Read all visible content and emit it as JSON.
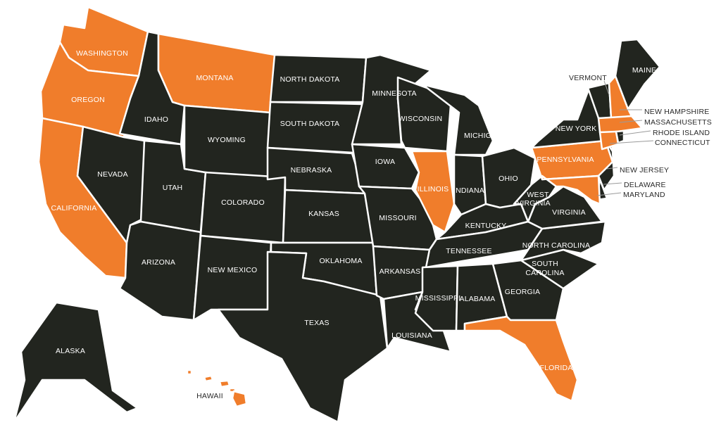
{
  "colors": {
    "highlighted": "#f07d2b",
    "default": "#22251f",
    "border": "#ffffff",
    "outside_label": "#2a2a2a"
  },
  "states": [
    {
      "id": "WA",
      "name": "WASHINGTON",
      "highlighted": true
    },
    {
      "id": "OR",
      "name": "OREGON",
      "highlighted": true
    },
    {
      "id": "CA",
      "name": "CALIFORNIA",
      "highlighted": true
    },
    {
      "id": "ID",
      "name": "IDAHO",
      "highlighted": false
    },
    {
      "id": "MT",
      "name": "MONTANA",
      "highlighted": true
    },
    {
      "id": "NV",
      "name": "NEVADA",
      "highlighted": false
    },
    {
      "id": "UT",
      "name": "UTAH",
      "highlighted": false
    },
    {
      "id": "AZ",
      "name": "ARIZONA",
      "highlighted": false
    },
    {
      "id": "WY",
      "name": "WYOMING",
      "highlighted": false
    },
    {
      "id": "CO",
      "name": "COLORADO",
      "highlighted": false
    },
    {
      "id": "NM",
      "name": "NEW  MEXICO",
      "highlighted": false
    },
    {
      "id": "ND",
      "name": "NORTH  DAKOTA",
      "highlighted": false
    },
    {
      "id": "SD",
      "name": "SOUTH  DAKOTA",
      "highlighted": false
    },
    {
      "id": "NE",
      "name": "NEBRASKA",
      "highlighted": false
    },
    {
      "id": "KS",
      "name": "KANSAS",
      "highlighted": false
    },
    {
      "id": "OK",
      "name": "OKLAHOMA",
      "highlighted": false
    },
    {
      "id": "TX",
      "name": "TEXAS",
      "highlighted": false
    },
    {
      "id": "MN",
      "name": "MINNESOTA",
      "highlighted": false
    },
    {
      "id": "IA",
      "name": "IOWA",
      "highlighted": false
    },
    {
      "id": "MO",
      "name": "MISSOURI",
      "highlighted": false
    },
    {
      "id": "AR",
      "name": "ARKANSAS",
      "highlighted": false
    },
    {
      "id": "LA",
      "name": "LOUISIANA",
      "highlighted": false
    },
    {
      "id": "WI",
      "name": "WISCONSIN",
      "highlighted": false
    },
    {
      "id": "IL",
      "name": "ILLINOIS",
      "highlighted": true
    },
    {
      "id": "MI",
      "name": "MICHIGAN",
      "highlighted": false
    },
    {
      "id": "IN",
      "name": "INDIANA",
      "highlighted": false
    },
    {
      "id": "OH",
      "name": "OHIO",
      "highlighted": false
    },
    {
      "id": "KY",
      "name": "KENTUCKY",
      "highlighted": false
    },
    {
      "id": "TN",
      "name": "TENNESSEE",
      "highlighted": false
    },
    {
      "id": "MS",
      "name": "MISSISSIPPI",
      "highlighted": false
    },
    {
      "id": "AL",
      "name": "ALABAMA",
      "highlighted": false
    },
    {
      "id": "GA",
      "name": "GEORGIA",
      "highlighted": false
    },
    {
      "id": "FL",
      "name": "FLORIDA",
      "highlighted": true
    },
    {
      "id": "SC",
      "name": "SOUTH CAROLINA",
      "highlighted": false
    },
    {
      "id": "NC",
      "name": "NORTH  CAROLINA",
      "highlighted": false
    },
    {
      "id": "VA",
      "name": "VIRGINIA",
      "highlighted": false
    },
    {
      "id": "WV",
      "name": "WEST VIRGINIA",
      "highlighted": false
    },
    {
      "id": "PA",
      "name": "PENNSYLVANIA",
      "highlighted": true
    },
    {
      "id": "NY",
      "name": "NEW  YORK",
      "highlighted": false
    },
    {
      "id": "NJ",
      "name": "NEW  JERSEY",
      "highlighted": false
    },
    {
      "id": "DE",
      "name": "DELAWARE",
      "highlighted": false
    },
    {
      "id": "MD",
      "name": "MARYLAND",
      "highlighted": true
    },
    {
      "id": "VT",
      "name": "VERMONT",
      "highlighted": false
    },
    {
      "id": "NH",
      "name": "NEW  HAMPSHIRE",
      "highlighted": true
    },
    {
      "id": "ME",
      "name": "MAINE",
      "highlighted": false
    },
    {
      "id": "MA",
      "name": "MASSACHUSETTS",
      "highlighted": true
    },
    {
      "id": "CT",
      "name": "CONNECTICUT",
      "highlighted": true
    },
    {
      "id": "RI",
      "name": "RHODE  ISLAND",
      "highlighted": false
    },
    {
      "id": "AK",
      "name": "ALASKA",
      "highlighted": false
    },
    {
      "id": "HI",
      "name": "HAWAII",
      "highlighted": true
    }
  ]
}
